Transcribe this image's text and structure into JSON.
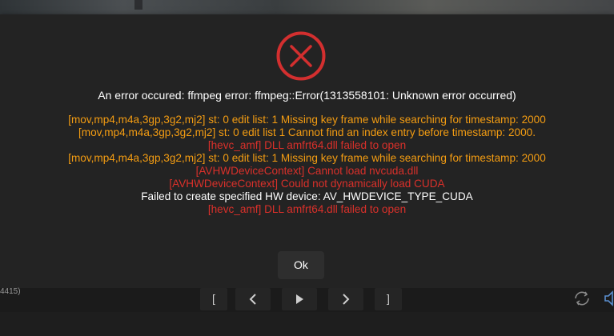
{
  "dialog": {
    "title": "An error occured: ffmpeg error: ffmpeg::Error(1313558101: Unknown error occurred)",
    "log_lines": [
      {
        "text": "[mov,mp4,m4a,3gp,3g2,mj2] st: 0 edit list: 1 Missing key frame while searching for timestamp: 2000",
        "level": "warning"
      },
      {
        "text": "[mov,mp4,m4a,3gp,3g2,mj2] st: 0 edit list 1 Cannot find an index entry before timestamp: 2000.",
        "level": "warning"
      },
      {
        "text": "[hevc_amf] DLL amfrt64.dll failed to open",
        "level": "error"
      },
      {
        "text": "[mov,mp4,m4a,3gp,3g2,mj2] st: 0 edit list: 1 Missing key frame while searching for timestamp: 2000",
        "level": "warning"
      },
      {
        "text": "[AVHWDeviceContext] Cannot load nvcuda.dll",
        "level": "error"
      },
      {
        "text": "[AVHWDeviceContext] Could not dynamically load CUDA",
        "level": "error"
      },
      {
        "text": "Failed to create specified HW device: AV_HWDEVICE_TYPE_CUDA",
        "level": "info"
      },
      {
        "text": "[hevc_amf] DLL amfrt64.dll failed to open",
        "level": "error"
      }
    ],
    "ok_label": "Ok",
    "icon": "error-circle-x-icon"
  },
  "player": {
    "side_text": "4415)",
    "controls": [
      {
        "name": "mark-in",
        "label": "["
      },
      {
        "name": "previous-frame",
        "icon": "chevron-left-icon"
      },
      {
        "name": "play",
        "icon": "play-icon"
      },
      {
        "name": "next-frame",
        "icon": "chevron-right-icon"
      },
      {
        "name": "mark-out",
        "label": "]"
      }
    ],
    "right_icons": [
      "rotate-icon",
      "volume-icon"
    ]
  },
  "colors": {
    "error": "#d9302a",
    "warning": "#f39c12",
    "info": "#ffffff",
    "modal_bg": "#232323",
    "icon_red": "#d32f2f"
  }
}
